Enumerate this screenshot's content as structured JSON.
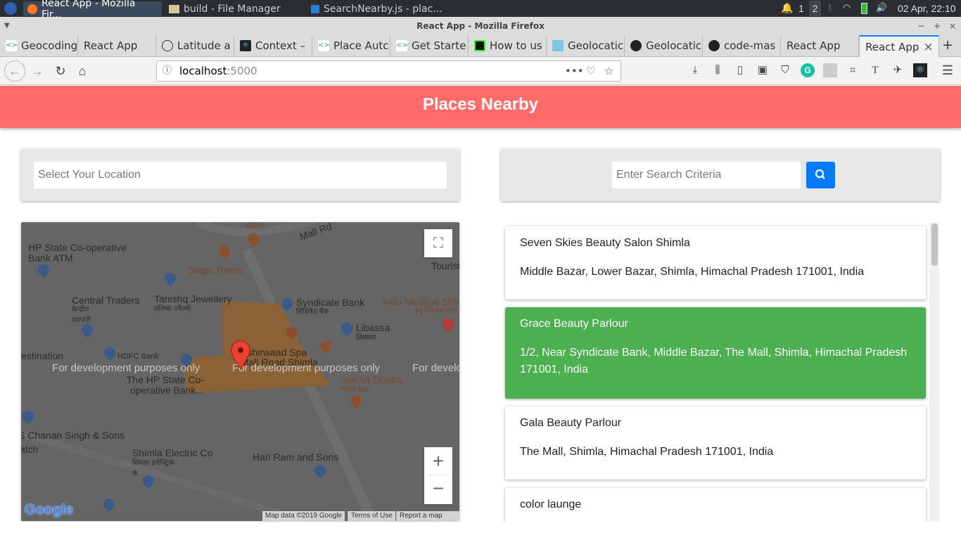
{
  "taskbar": {
    "tasks": [
      "React App - Mozilla Fir...",
      "build - File Manager",
      "SearchNearby.js - plac..."
    ],
    "workspaces": [
      "1",
      "2"
    ],
    "clock": "02 Apr, 22:10"
  },
  "window": {
    "title": "React App - Mozilla Firefox"
  },
  "tabs": [
    {
      "label": "Geocoding"
    },
    {
      "label": "React App"
    },
    {
      "label": "Latitude a"
    },
    {
      "label": "Context –"
    },
    {
      "label": "Place Autc"
    },
    {
      "label": "Get Starte"
    },
    {
      "label": "How to us"
    },
    {
      "label": "Geolocatic"
    },
    {
      "label": "Geolocatic"
    },
    {
      "label": "code-mas"
    },
    {
      "label": "React App"
    },
    {
      "label": "React App"
    }
  ],
  "url": {
    "host": "localhost",
    "port": ":5000"
  },
  "app": {
    "title": "Places Nearby",
    "location_placeholder": "Select Your Location",
    "search_placeholder": "Enter Search Criteria",
    "places": [
      {
        "name": "Seven Skies Beauty Salon Shimla",
        "address": "Middle Bazar, Lower Bazar, Shimla, Himachal Pradesh 171001, India"
      },
      {
        "name": "Grace Beauty Parlour",
        "address": "1/2, Near Syndicate Bank, Middle Bazar, The Mall, Shimla, Himachal Pradesh 171001, India"
      },
      {
        "name": "Gala Beauty Parlour",
        "address": "The Mall, Shimla, Himachal Pradesh 171001, India"
      },
      {
        "name": "color launge",
        "address": ""
      }
    ],
    "selected_color": "#4caf50"
  },
  "map": {
    "labels": [
      "Mall Rd",
      "HP State Co-operative Bank ATM",
      "Sagar Ratna",
      "Tourist",
      "Central Traders",
      "केन्द्रीय व्यापारी",
      "Tanishq Jewellery",
      "तनिष्क ज्वैलरी",
      "Syndicate Bank",
      "सिंडिकेट बैंक",
      "Indu Medical Store",
      "इंदु मेडिकल स्टोर",
      "Libassa",
      "लिबस्सा",
      "estination",
      "HDFC Bank",
      "Ashirwaad Spa",
      "Mall Road Shimla",
      "The HP State Co-operative Bank...",
      "Golcha Dhaba",
      "गोलचा ढाबा",
      "S Chanan Singh & Sons",
      "atch",
      "Shimla Electric Co",
      "शिमला इलेक्ट्रिक कं",
      "Hari Ram and Sons",
      "फ़ैमिली..."
    ],
    "watermark": "For development purposes only",
    "logo": "Google",
    "attribution": [
      "Map data ©2019 Google",
      "Terms of Use",
      "Report a map error"
    ]
  }
}
